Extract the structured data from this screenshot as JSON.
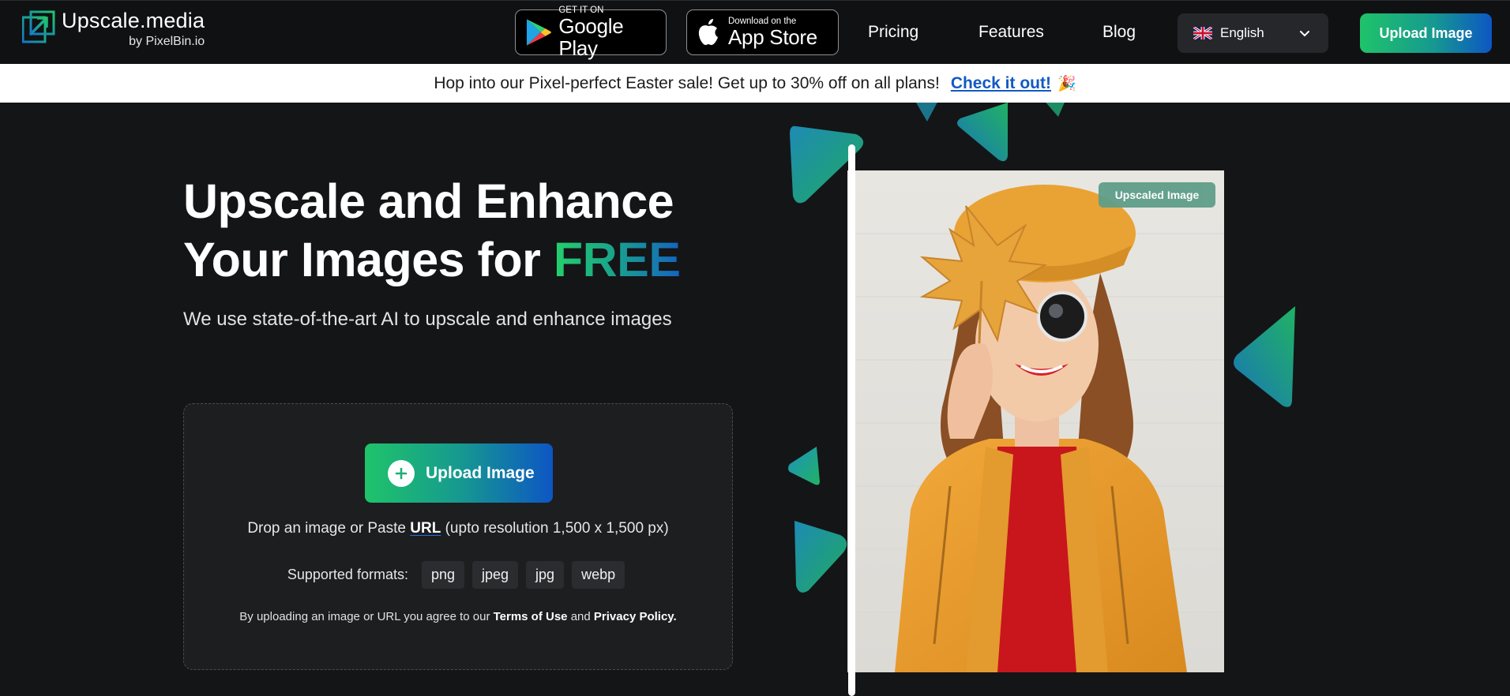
{
  "nav": {
    "logo_name": "Upscale.media",
    "logo_by": "by PixelBin.io",
    "google_play_small": "GET IT ON",
    "google_play_big": "Google Play",
    "app_store_small": "Download on the",
    "app_store_big": "App Store",
    "links": [
      "Pricing",
      "Features",
      "Blog"
    ],
    "language": "English",
    "upload_label": "Upload Image"
  },
  "banner": {
    "text": "Hop into our Pixel-perfect Easter sale! Get up to 30% off on all plans!",
    "link": "Check it out!",
    "emoji": "🎉"
  },
  "hero": {
    "title_line1": "Upscale and Enhance",
    "title_line2": "Your Images for ",
    "title_highlight": "FREE",
    "subtitle": "We use state-of-the-art AI to upscale and enhance images"
  },
  "upload_card": {
    "button_label": "Upload Image",
    "drop_prefix": "Drop an image or Paste ",
    "drop_url": "URL",
    "drop_suffix": " (upto resolution 1,500 x 1,500 px)",
    "formats_label": "Supported formats:",
    "formats": [
      "png",
      "jpeg",
      "jpg",
      "webp"
    ],
    "terms_prefix": "By uploading an image or URL you agree to our ",
    "terms_link": "Terms of Use",
    "terms_and": " and ",
    "privacy_link": "Privacy Policy."
  },
  "showcase": {
    "badge": "Upscaled Image"
  },
  "colors": {
    "brand_green": "#1fc36a",
    "brand_blue": "#0d56c4",
    "background": "#141517",
    "banner_link": "#1259c3"
  }
}
